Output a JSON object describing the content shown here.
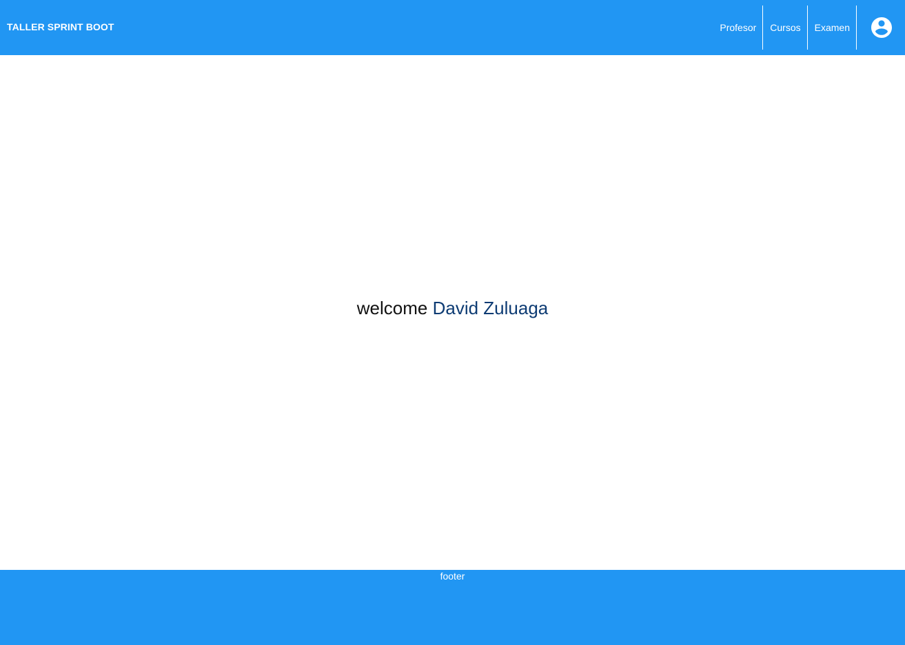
{
  "header": {
    "brand": "TALLER SPRINT BOOT",
    "nav": {
      "profesor": "Profesor",
      "cursos": "Cursos",
      "examen": "Examen"
    },
    "account_icon": "account-circle-icon"
  },
  "main": {
    "welcome_prefix": "welcome",
    "user_name": "David Zuluaga"
  },
  "footer": {
    "text": "footer"
  },
  "colors": {
    "primary": "#2196f3",
    "user_name": "#0d3b73",
    "background": "#ffffff"
  }
}
